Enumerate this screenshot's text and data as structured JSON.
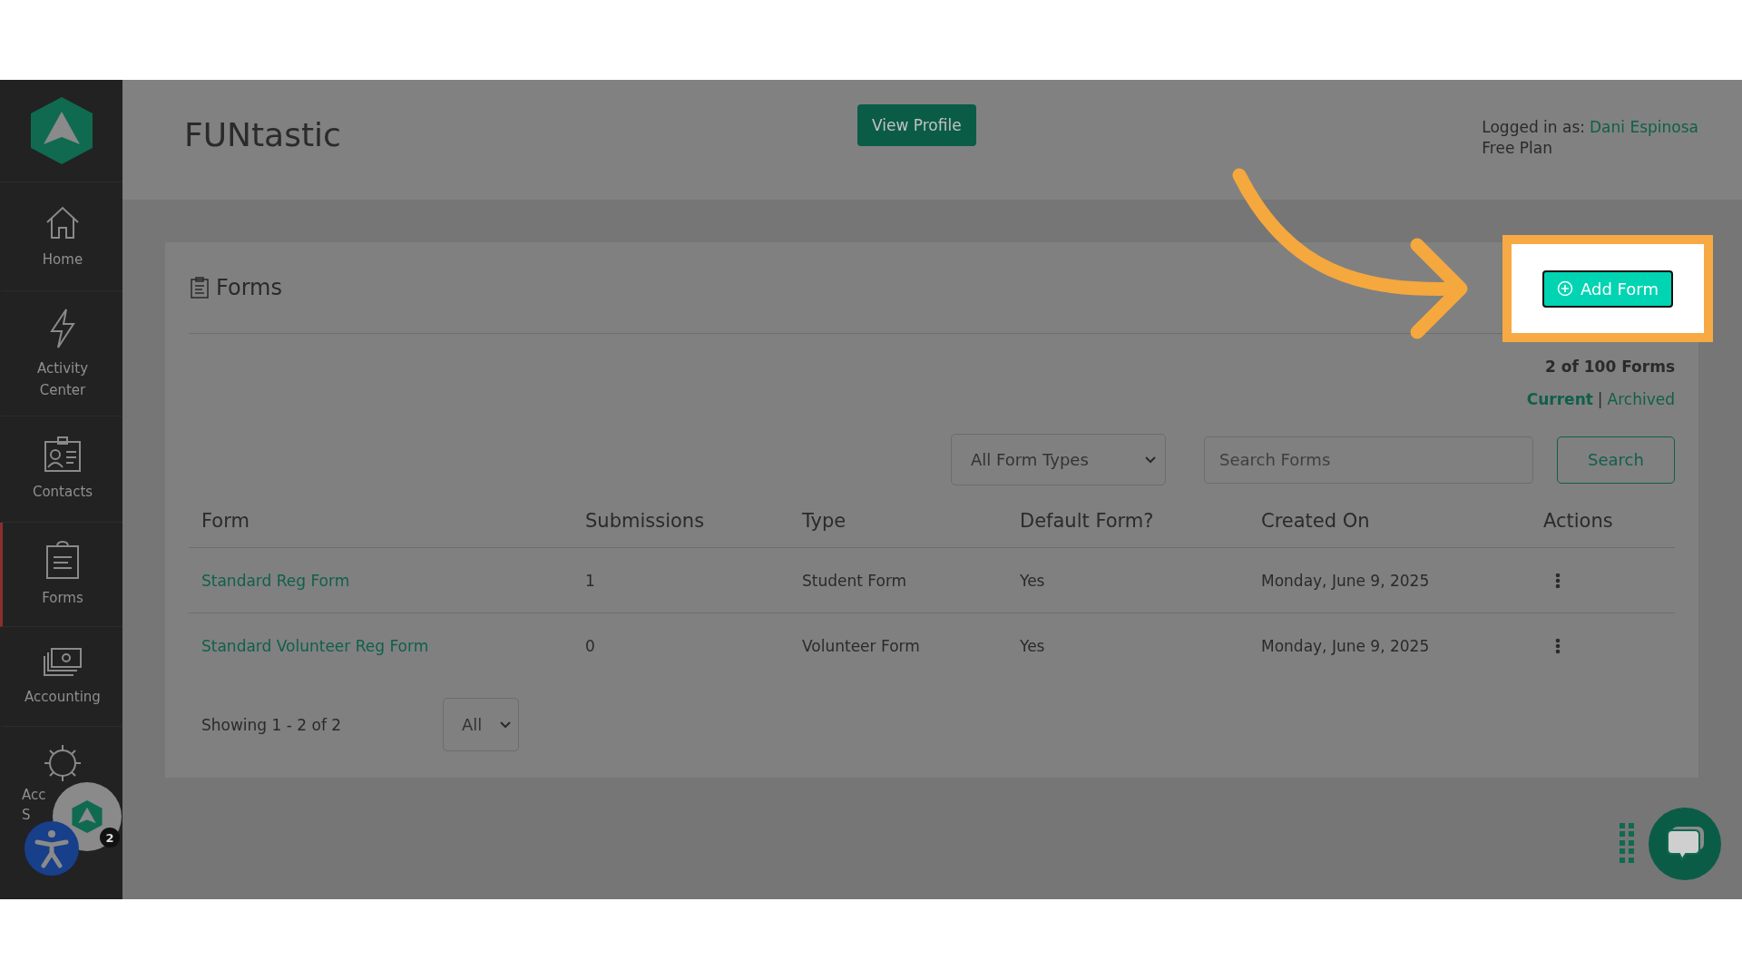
{
  "sidebar": {
    "items": [
      {
        "kind": "home",
        "label_lines": [
          "Home"
        ],
        "selected": false
      },
      {
        "kind": "activity",
        "label_lines": [
          "Activity",
          "Center"
        ],
        "selected": false
      },
      {
        "kind": "contacts",
        "label_lines": [
          "Contacts"
        ],
        "selected": false
      },
      {
        "kind": "forms",
        "label_lines": [
          "Forms"
        ],
        "selected": true
      },
      {
        "kind": "accounting",
        "label_lines": [
          "Accounting"
        ],
        "selected": false
      },
      {
        "kind": "settings",
        "label_lines": [
          "Acc",
          "S"
        ],
        "selected": false
      }
    ]
  },
  "header": {
    "title": "FUNtastic",
    "view_profile_button": "View Profile",
    "logged_in_label": "Logged in as:",
    "user_name": "Dani Espinosa",
    "plan": "Free Plan"
  },
  "forms_panel": {
    "title": "Forms",
    "add_button": "Add Form",
    "count": "2 of 100 Forms",
    "views": [
      {
        "label": "Current",
        "selected": true
      },
      {
        "label": "Archived",
        "selected": false
      }
    ],
    "separator": "|",
    "type_filter": "All Form Types",
    "search_placeholder": "Search Forms",
    "search_button": "Search",
    "table": {
      "columns": [
        "Form",
        "Submissions",
        "Type",
        "Default Form?",
        "Created On",
        "Actions"
      ],
      "rows": [
        {
          "form": "Standard Reg Form",
          "submissions": "1",
          "type": "Student Form",
          "default": "Yes",
          "created_on": "Monday, June 9, 2025"
        },
        {
          "form": "Standard Volunteer Reg Form",
          "submissions": "0",
          "type": "Volunteer Form",
          "default": "Yes",
          "created_on": "Monday, June 9, 2025"
        }
      ]
    },
    "showing": "Showing 1 - 2 of 2",
    "page_size": "All"
  },
  "widgets": {
    "notification_badge": "2"
  }
}
